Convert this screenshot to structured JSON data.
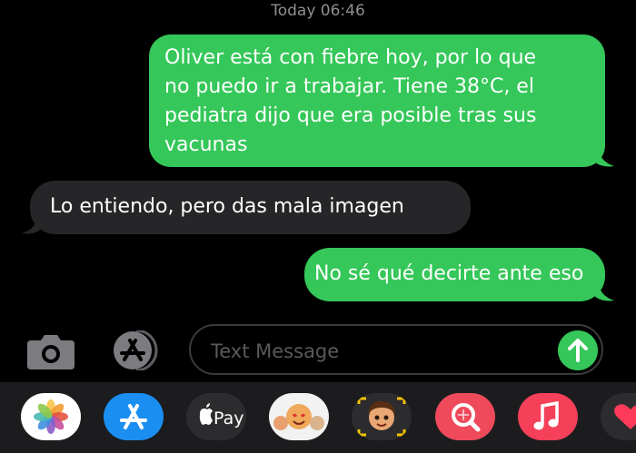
{
  "timestamp": "Today 06:46",
  "messages": [
    {
      "direction": "outgoing",
      "lines": [
        "Oliver está con fiebre hoy, por lo que",
        "no puedo ir a trabajar. Tiene 38°C, el",
        "pediatra dijo que era posible tras sus",
        "vacunas"
      ]
    },
    {
      "direction": "incoming",
      "lines": [
        "Lo entiendo, pero das mala imagen"
      ]
    },
    {
      "direction": "outgoing",
      "lines": [
        "No sé qué decirte ante eso"
      ]
    }
  ],
  "composer": {
    "placeholder": "Text Message",
    "icons": [
      "camera-icon",
      "app-store-icon",
      "send-arrow-icon"
    ]
  },
  "app_drawer": {
    "apps": [
      {
        "icon": "photos-icon"
      },
      {
        "icon": "app-store-icon"
      },
      {
        "icon": "apple-pay-icon",
        "label": "Pay"
      },
      {
        "icon": "memoji-stickers-icon"
      },
      {
        "icon": "memoji-icon"
      },
      {
        "icon": "image-search-icon"
      },
      {
        "icon": "music-icon"
      },
      {
        "icon": "digital-touch-icon"
      }
    ]
  },
  "colors": {
    "outgoing_bubble": "#35c759",
    "incoming_bubble": "#262628",
    "background": "#000000",
    "drawer": "#1c1c1e"
  }
}
